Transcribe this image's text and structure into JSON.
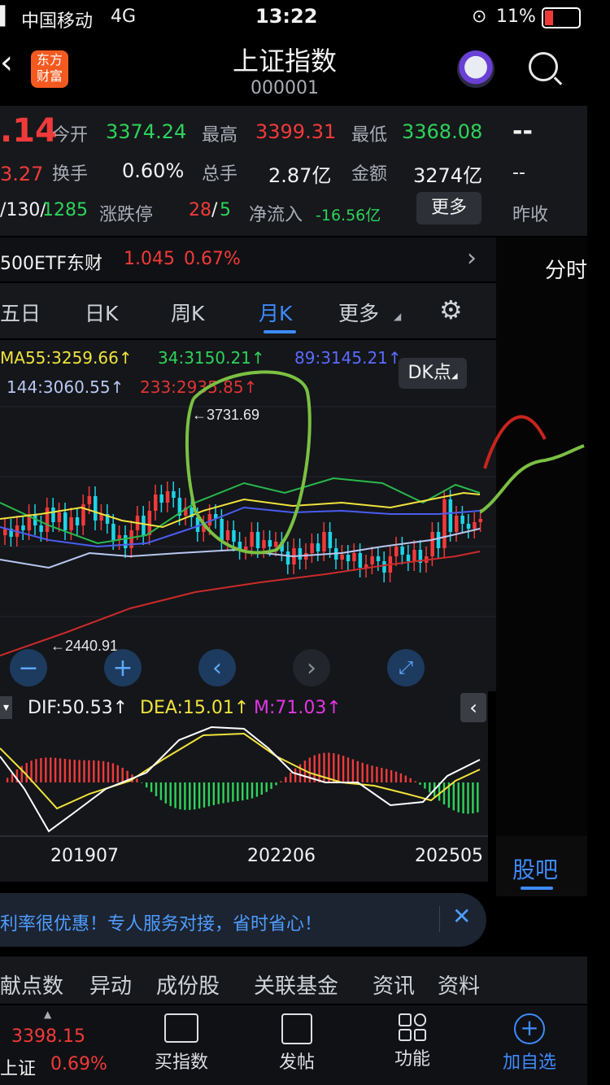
{
  "status": {
    "carrier": "中国移动",
    "network": "4G",
    "time": "13:22",
    "battery": "11%"
  },
  "header": {
    "title": "上证指数",
    "code": "000001",
    "logo_text": "东方财富"
  },
  "quote": {
    "price_partial": ".14",
    "change_partial": "3.27",
    "open_label": "今开",
    "open": "3374.24",
    "high_label": "最高",
    "high": "3399.31",
    "low_label": "最低",
    "low": "3368.08",
    "turnover_label": "换手",
    "turnover": "0.60%",
    "volume_label": "总手",
    "volume": "2.87亿",
    "amount_label": "金额",
    "amount": "3274亿",
    "breadth": "/130/",
    "breadth_green": "1285",
    "limit_label": "涨跌停",
    "limit_up": "28",
    "limit_sep": "/",
    "limit_down": "5",
    "flow_label": "净流入",
    "flow": "-16.56亿",
    "more": "更多",
    "right_top": "--",
    "right_mid": "--",
    "prev_close": "昨收"
  },
  "etf": {
    "name": "500ETF东财",
    "price": "1.045",
    "change": "0.67%"
  },
  "right_tabs": {
    "intraday": "分时",
    "guba": "股吧"
  },
  "period_tabs": [
    "五日",
    "日K",
    "周K",
    "月K",
    "更多"
  ],
  "ma": {
    "ma55": "MA55:3259.66↑",
    "ma34": "34:3150.21↑",
    "ma89": "89:3145.21↑",
    "ma144": "144:3060.55↑",
    "ma233": "233:2935.85↑",
    "dk": "DK点"
  },
  "chart_data": {
    "type": "candlestick",
    "max_label": "←3731.69",
    "min_label": "←2440.91",
    "x_ticks": [
      "201907",
      "202206",
      "202505"
    ],
    "macd": {
      "dif": "DIF:50.53↑",
      "dea": "DEA:15.01↑",
      "m": "M:71.03↑"
    }
  },
  "ad": {
    "text": "利率很优惠！专人服务对接，省时省心！"
  },
  "sections": [
    "献点数",
    "异动",
    "成份股",
    "关联基金",
    "资讯",
    "资料"
  ],
  "bottom": {
    "index_price": "3398.15",
    "index_name": "上证",
    "index_change": "0.69%",
    "items": [
      "买指数",
      "发帖",
      "功能",
      "加自选"
    ]
  },
  "colors": {
    "up": "#f03a3a",
    "down": "#2ed35a",
    "accent": "#3d8bfd"
  }
}
